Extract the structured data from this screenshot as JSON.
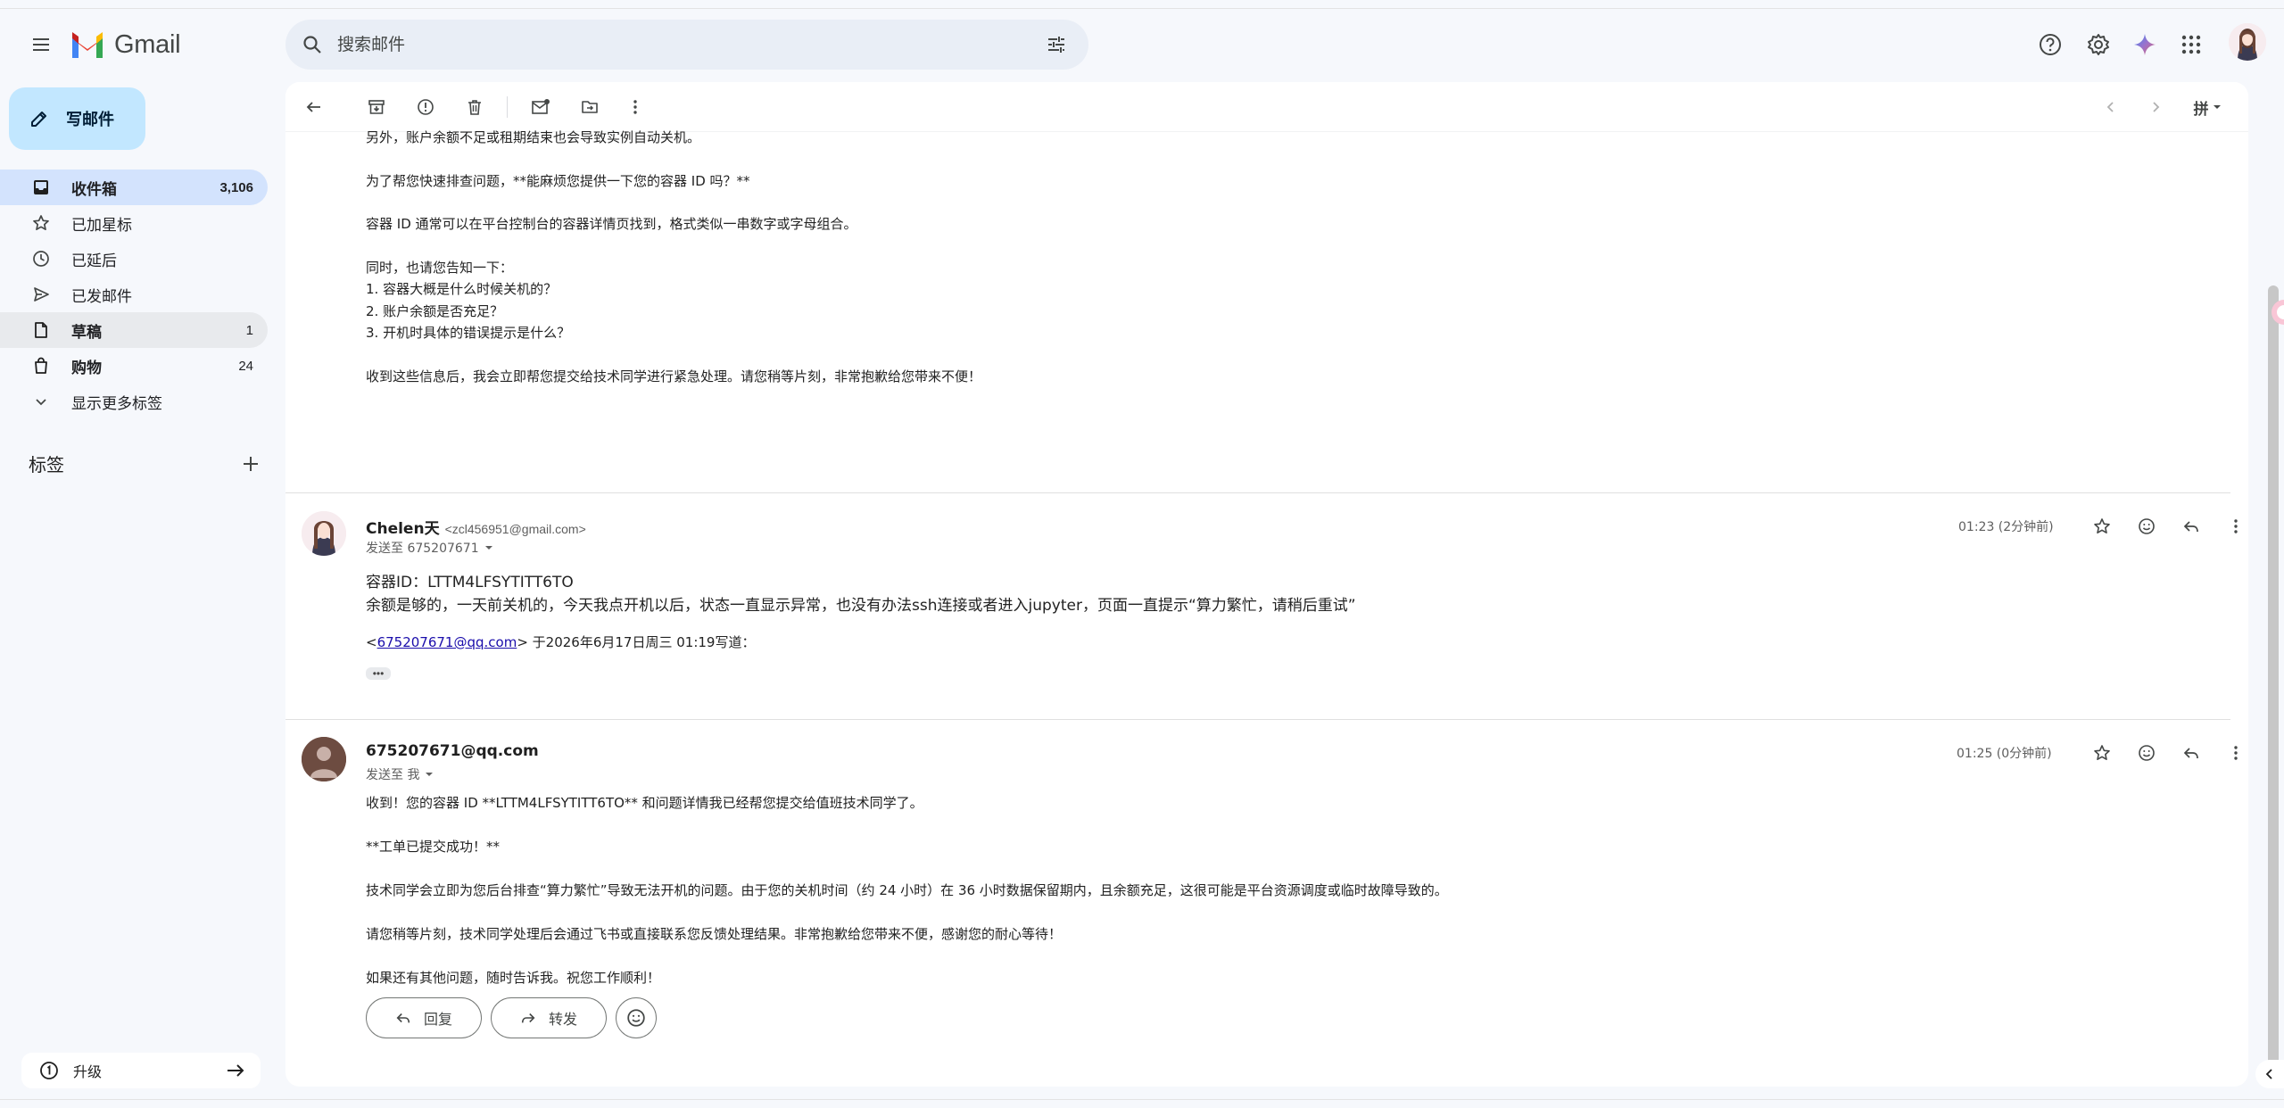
{
  "app": {
    "logo_text": "Gmail"
  },
  "search": {
    "placeholder": "搜索邮件"
  },
  "compose": {
    "label": "写邮件"
  },
  "sidebar": {
    "items": [
      {
        "label": "收件箱",
        "count": "3,106",
        "icon": "inbox-icon"
      },
      {
        "label": "已加星标",
        "count": "",
        "icon": "star-icon"
      },
      {
        "label": "已延后",
        "count": "",
        "icon": "clock-icon"
      },
      {
        "label": "已发邮件",
        "count": "",
        "icon": "send-icon"
      },
      {
        "label": "草稿",
        "count": "1",
        "icon": "draft-icon"
      },
      {
        "label": "购物",
        "count": "24",
        "icon": "shopping-icon"
      },
      {
        "label": "显示更多标签",
        "count": "",
        "icon": "chevron-down-icon"
      }
    ],
    "labels_title": "标签",
    "upgrade_label": "升级"
  },
  "toolbar": {
    "input_method": "拼"
  },
  "thread": {
    "prev_tail": [
      "另外，账户余额不足或租期结束也会导致实例自动关机。",
      "为了帮您快速排查问题，**能麻烦您提供一下您的容器 ID 吗？**",
      "容器 ID 通常可以在平台控制台的容器详情页找到，格式类似一串数字或字母组合。",
      "同时，也请您告知一下：",
      "1. 容器大概是什么时候关机的？",
      "2. 账户余额是否充足？",
      "3. 开机时具体的错误提示是什么？",
      "收到这些信息后，我会立即帮您提交给技术同学进行紧急处理。请您稍等片刻，非常抱歉给您带来不便！"
    ],
    "msg1": {
      "sender_name": "Chelen天",
      "sender_email": "<zcl456951@gmail.com>",
      "to": "发送至 675207671",
      "time": "01:23 (2分钟前)",
      "line1": "容器ID：LTTM4LFSYTITT6TO",
      "line2": "余额是够的，一天前关机的，今天我点开机以后，状态一直显示异常，也没有办法ssh连接或者进入jupyter，页面一直提示“算力繁忙，请稍后重试”",
      "quote_prefix": "<",
      "quote_link": "675207671@qq.com",
      "quote_suffix": "> 于2026年6月17日周三 01:19写道：",
      "ellipsis": "•••"
    },
    "msg2": {
      "sender_name": "675207671@qq.com",
      "to": "发送至 我",
      "time": "01:25 (0分钟前)",
      "paragraphs": [
        "收到！您的容器 ID **LTTM4LFSYTITT6TO** 和问题详情我已经帮您提交给值班技术同学了。",
        "**工单已提交成功！**",
        "技术同学会立即为您后台排查“算力繁忙”导致无法开机的问题。由于您的关机时间（约 24 小时）在 36 小时数据保留期内，且余额充足，这很可能是平台资源调度或临时故障导致的。",
        "请您稍等片刻，技术同学处理后会通过飞书或直接联系您反馈处理结果。非常抱歉给您带来不便，感谢您的耐心等待！",
        "如果还有其他问题，随时告诉我。祝您工作顺利！"
      ]
    },
    "reply_label": "回复",
    "forward_label": "转发"
  },
  "colors": {
    "accent": "#c2e7ff",
    "active_nav": "#d3e3fd",
    "background": "#f6f8fc"
  }
}
